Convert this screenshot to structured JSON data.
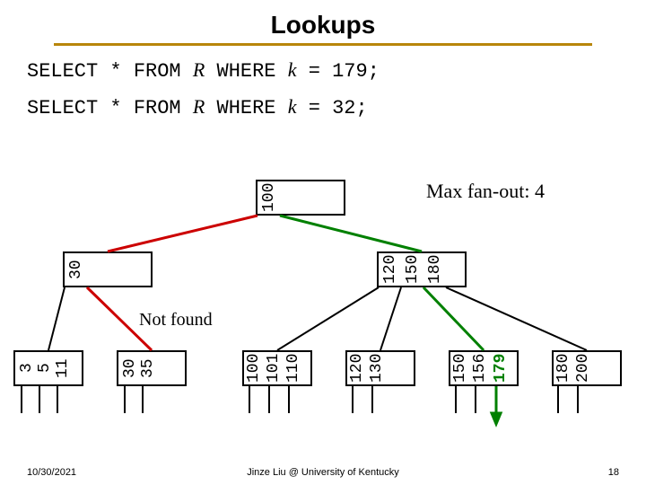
{
  "title": "Lookups",
  "queries": [
    {
      "prefix": "SELECT * FROM",
      "table": "R",
      "mid": "WHERE",
      "col": "k",
      "suffix": "= 179;"
    },
    {
      "prefix": "SELECT * FROM",
      "table": "R",
      "mid": "WHERE",
      "col": "k",
      "suffix": "= 32;"
    }
  ],
  "fanout": "Max fan-out: 4",
  "notfound": "Not found",
  "tree": {
    "root": [
      "100"
    ],
    "internal": [
      {
        "keys": [
          "30"
        ]
      },
      {
        "keys": [
          "120",
          "150",
          "180"
        ]
      }
    ],
    "leaves": [
      [
        "3",
        "5",
        "11"
      ],
      [
        "30",
        "35"
      ],
      [
        "100",
        "101",
        "110"
      ],
      [
        "120",
        "130"
      ],
      [
        "150",
        "156",
        "179"
      ],
      [
        "180",
        "200"
      ]
    ]
  },
  "search_paths": {
    "green_found": {
      "target": 179,
      "path": [
        "root",
        "internal-right",
        "leaf-4",
        "179-pointer"
      ]
    },
    "red_notfound": {
      "target": 32,
      "path": [
        "root",
        "internal-left",
        "leaf-1"
      ]
    }
  },
  "footer": {
    "date": "10/30/2021",
    "center": "Jinze Liu @ University of Kentucky",
    "page": "18"
  }
}
